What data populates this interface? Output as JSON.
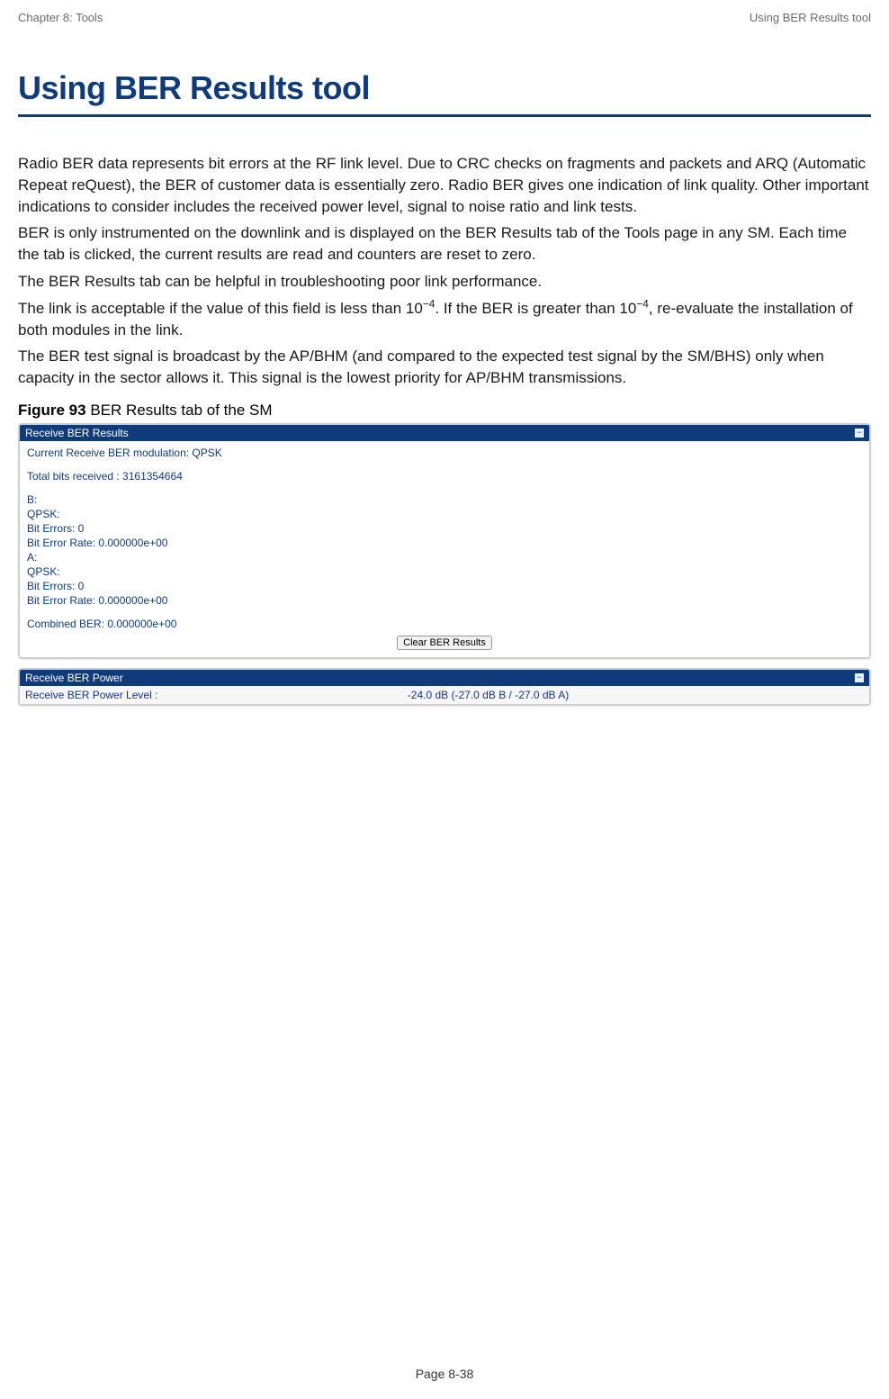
{
  "header": {
    "left": "Chapter 8:  Tools",
    "right": "Using BER Results tool"
  },
  "title": "Using BER Results tool",
  "paragraphs": {
    "p1": "Radio BER data represents bit errors at the RF link level. Due to CRC checks on fragments and packets and ARQ (Automatic Repeat reQuest), the BER of customer data is essentially zero. Radio BER gives one indication of link quality. Other important indications to consider includes the received power level, signal to noise ratio and link tests.",
    "p2": "BER is only instrumented on the downlink and is displayed on the BER Results tab of the Tools page in any SM. Each time the tab is clicked, the current results are read and counters are reset to zero.",
    "p3": "The BER Results tab can be helpful in troubleshooting poor link performance.",
    "p4_a": "The link is acceptable if the value of this field is less than 10",
    "p4_sup1": "−4",
    "p4_b": ".  If the BER is greater than 10",
    "p4_sup2": "−4",
    "p4_c": ", re-evaluate the installation of both modules in the link.",
    "p5": "The BER test signal is broadcast by the AP/BHM (and compared to the expected test signal by the SM/BHS) only when capacity in the sector allows it. This signal is the lowest priority for AP/BHM transmissions."
  },
  "figure": {
    "label_bold": "Figure 93",
    "label_rest": "  BER Results tab of the SM"
  },
  "panel1": {
    "title": "Receive BER Results",
    "body": {
      "l1": "Current Receive BER modulation: QPSK",
      "l2": "Total bits received : 3161354664",
      "l3": "B:",
      "l4": "QPSK:",
      "l5": "Bit Errors: 0",
      "l6": "Bit Error Rate: 0.000000e+00",
      "l7": "A:",
      "l8": "QPSK:",
      "l9": "Bit Errors: 0",
      "l10": "Bit Error Rate: 0.000000e+00",
      "l11": "Combined BER: 0.000000e+00"
    },
    "button": "Clear BER Results"
  },
  "panel2": {
    "title": "Receive BER Power",
    "row_label": "Receive BER Power Level :",
    "row_value": "-24.0 dB (-27.0 dB B / -27.0 dB A)"
  },
  "footer": "Page 8-38"
}
